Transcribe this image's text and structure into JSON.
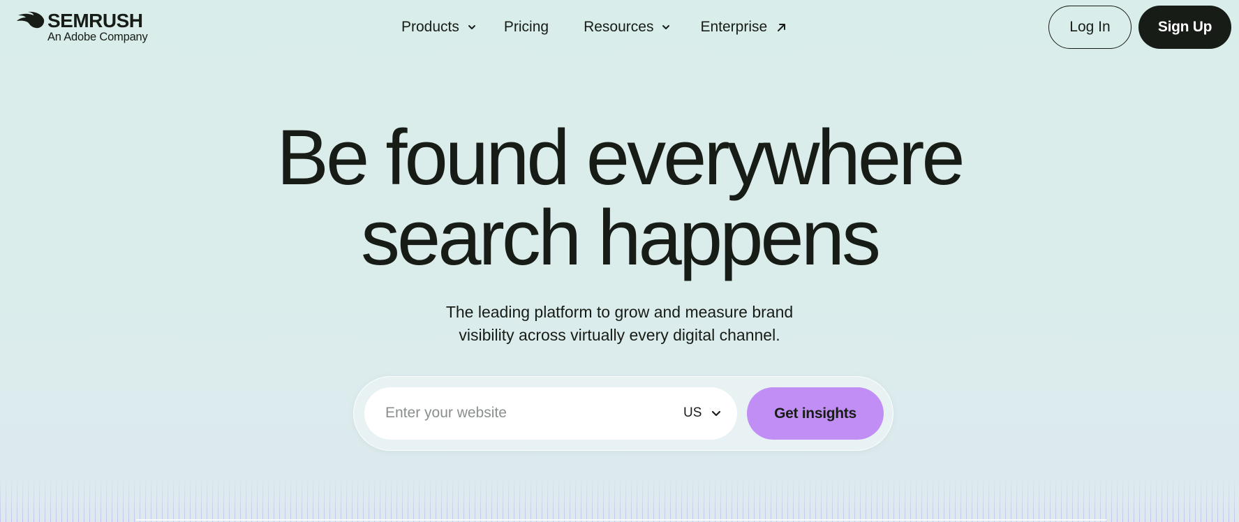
{
  "brand": {
    "name": "SEMRUSH",
    "tagline": "An Adobe Company",
    "logo_icon": "semrush-flame-icon"
  },
  "nav": {
    "items": [
      {
        "label": "Products",
        "icon": "chevron-down-icon"
      },
      {
        "label": "Pricing"
      },
      {
        "label": "Resources",
        "icon": "chevron-down-icon"
      },
      {
        "label": "Enterprise",
        "icon": "external-arrow-icon"
      }
    ],
    "login_label": "Log In",
    "signup_label": "Sign Up"
  },
  "hero": {
    "title_line1": "Be found everywhere",
    "title_line2": "search happens",
    "subtitle_line1": "The leading platform to grow and measure brand",
    "subtitle_line2": "visibility across virtually every digital channel."
  },
  "search": {
    "placeholder": "Enter your website",
    "value": "",
    "country": "US",
    "button_label": "Get insights"
  },
  "colors": {
    "background": "#d9edea",
    "text": "#171c16",
    "signup_bg": "#171c16",
    "cta": "#c08ef5",
    "stripes": "#b0a0e6"
  }
}
